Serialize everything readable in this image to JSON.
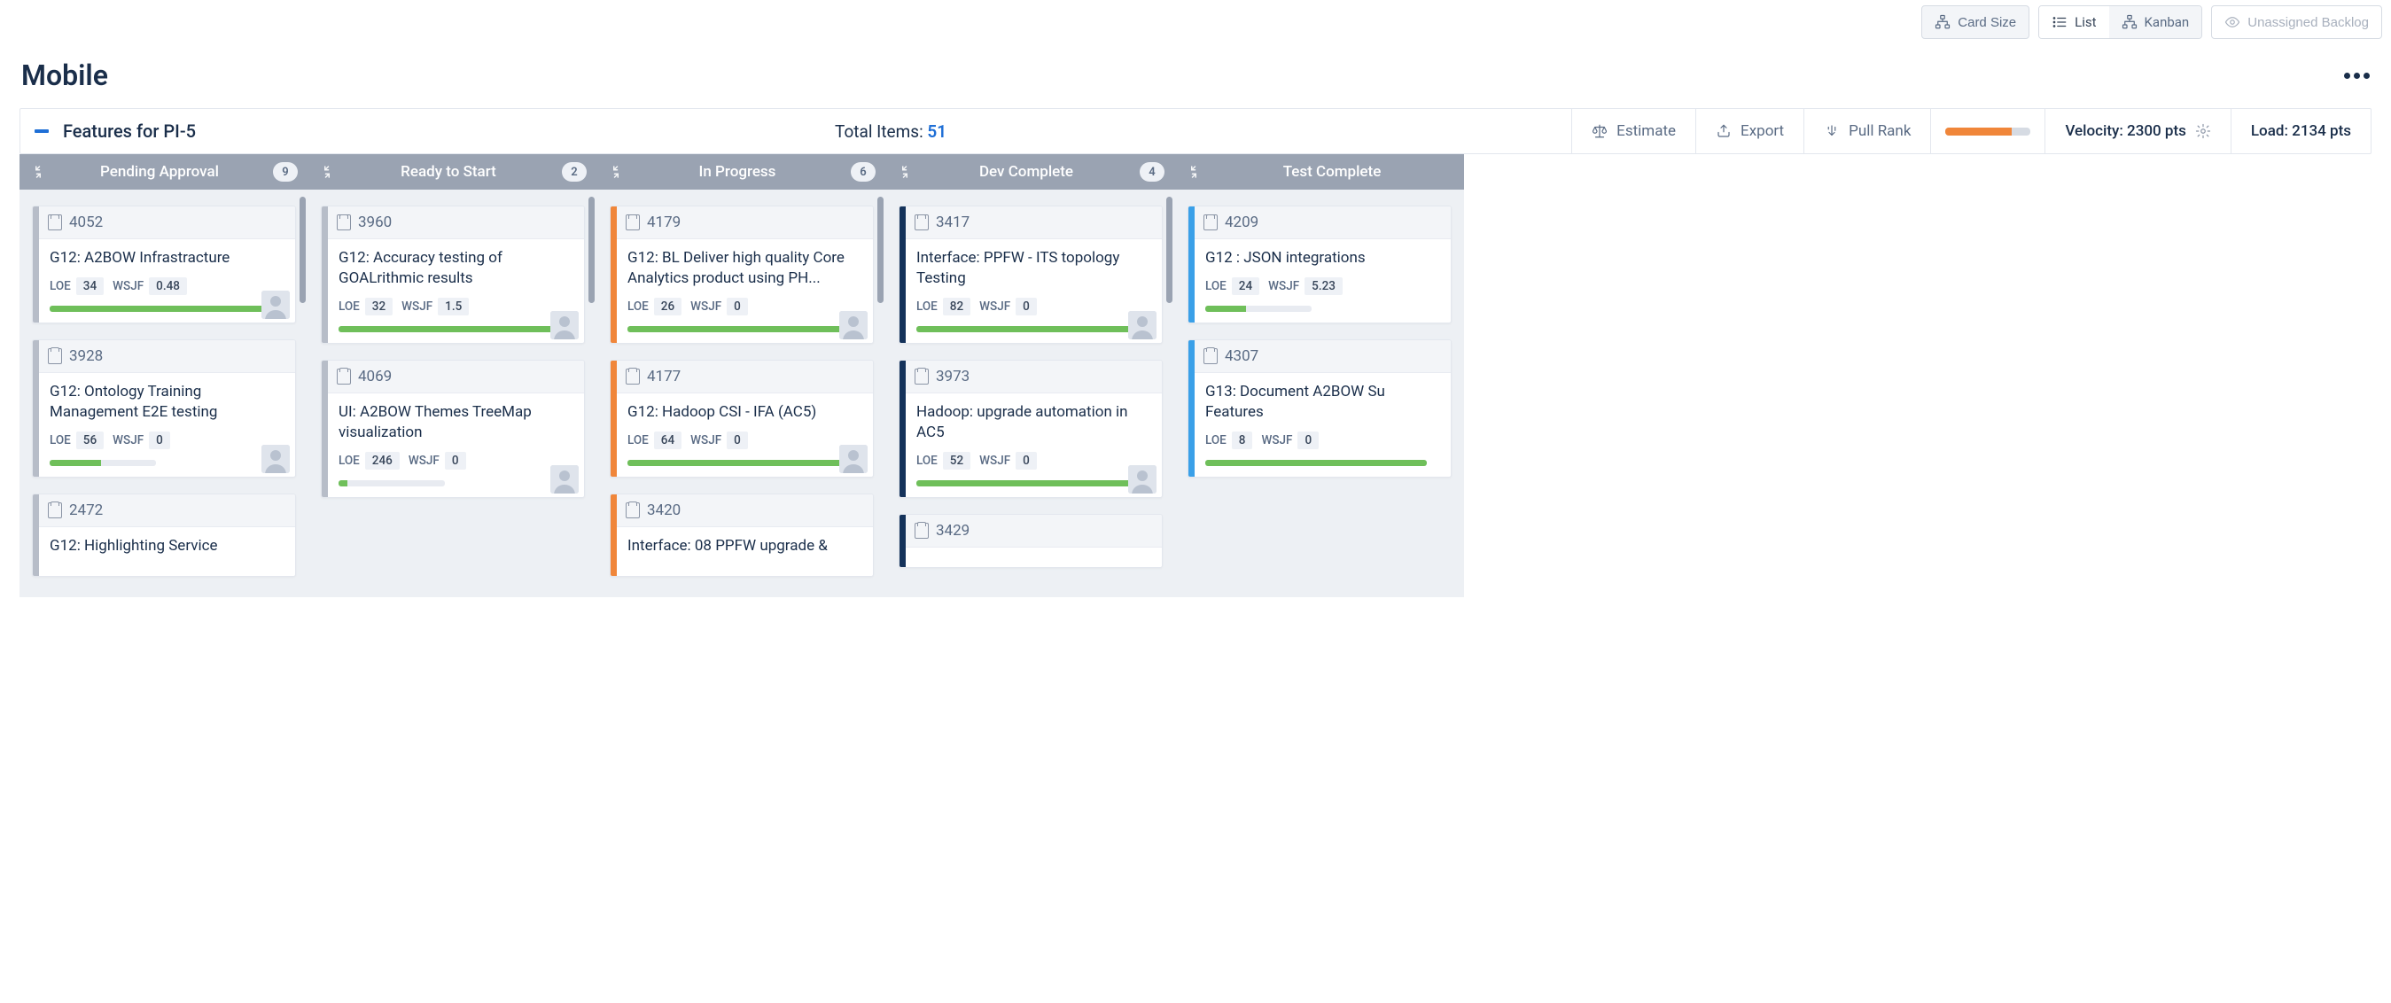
{
  "toolbar": {
    "card_size": "Card Size",
    "list": "List",
    "kanban": "Kanban",
    "unassigned": "Unassigned Backlog"
  },
  "page_title": "Mobile",
  "controls": {
    "features_for": "Features for  PI-5",
    "total_items_label": "Total Items:",
    "total_items_count": "51",
    "estimate": "Estimate",
    "export": "Export",
    "pull_rank": "Pull Rank",
    "progress_pct": 78,
    "velocity": "Velocity: 2300 pts",
    "load": "Load: 2134 pts"
  },
  "labels": {
    "loe": "LOE",
    "wsjf": "WSJF"
  },
  "columns": [
    {
      "title": "Pending Approval",
      "count": "9",
      "accent": "grey",
      "cards": [
        {
          "id": "4052",
          "title": "G12: A2BOW Infrastracture",
          "loe": "34",
          "wsjf": "0.48",
          "progress": 100,
          "avatar": true
        },
        {
          "id": "3928",
          "title": "G12: Ontology Training Management E2E testing",
          "loe": "56",
          "wsjf": "0",
          "progress": 48,
          "avatar": true
        },
        {
          "id": "2472",
          "title": "G12: Highlighting Service",
          "loe": "",
          "wsjf": "",
          "progress": 0,
          "avatar": false,
          "partial": true
        }
      ]
    },
    {
      "title": "Ready to Start",
      "count": "2",
      "accent": "grey",
      "cards": [
        {
          "id": "3960",
          "title": "G12: Accuracy testing of GOALrithmic results",
          "loe": "32",
          "wsjf": "1.5",
          "progress": 100,
          "avatar": true
        },
        {
          "id": "4069",
          "title": "UI: A2BOW Themes TreeMap visualization",
          "loe": "246",
          "wsjf": "0",
          "progress": 8,
          "avatar": true
        }
      ]
    },
    {
      "title": "In Progress",
      "count": "6",
      "accent": "orange",
      "cards": [
        {
          "id": "4179",
          "title": "G12: BL Deliver high quality Core Analytics product using PH...",
          "loe": "26",
          "wsjf": "0",
          "progress": 100,
          "avatar": true
        },
        {
          "id": "4177",
          "title": "G12: Hadoop CSI - IFA (AC5)",
          "loe": "64",
          "wsjf": "0",
          "progress": 100,
          "avatar": true
        },
        {
          "id": "3420",
          "title": "Interface: 08 PPFW upgrade &",
          "loe": "",
          "wsjf": "",
          "progress": 0,
          "avatar": false,
          "partial": true
        }
      ]
    },
    {
      "title": "Dev Complete",
      "count": "4",
      "accent": "navy",
      "cards": [
        {
          "id": "3417",
          "title": "Interface: PPFW - ITS topology Testing",
          "loe": "82",
          "wsjf": "0",
          "progress": 100,
          "avatar": true
        },
        {
          "id": "3973",
          "title": "Hadoop: upgrade automation in AC5",
          "loe": "52",
          "wsjf": "0",
          "progress": 100,
          "avatar": true
        },
        {
          "id": "3429",
          "title": "",
          "loe": "",
          "wsjf": "",
          "progress": 0,
          "avatar": false,
          "partial": true
        }
      ]
    },
    {
      "title": "Test Complete",
      "count": "",
      "accent": "blue",
      "cards": [
        {
          "id": "4209",
          "title": "G12 : JSON integrations",
          "loe": "24",
          "wsjf": "5.23",
          "progress": 38,
          "avatar": false
        },
        {
          "id": "4307",
          "title": "G13: Document A2BOW Su Features",
          "loe": "8",
          "wsjf": "0",
          "progress": 100,
          "avatar": false
        }
      ]
    }
  ]
}
